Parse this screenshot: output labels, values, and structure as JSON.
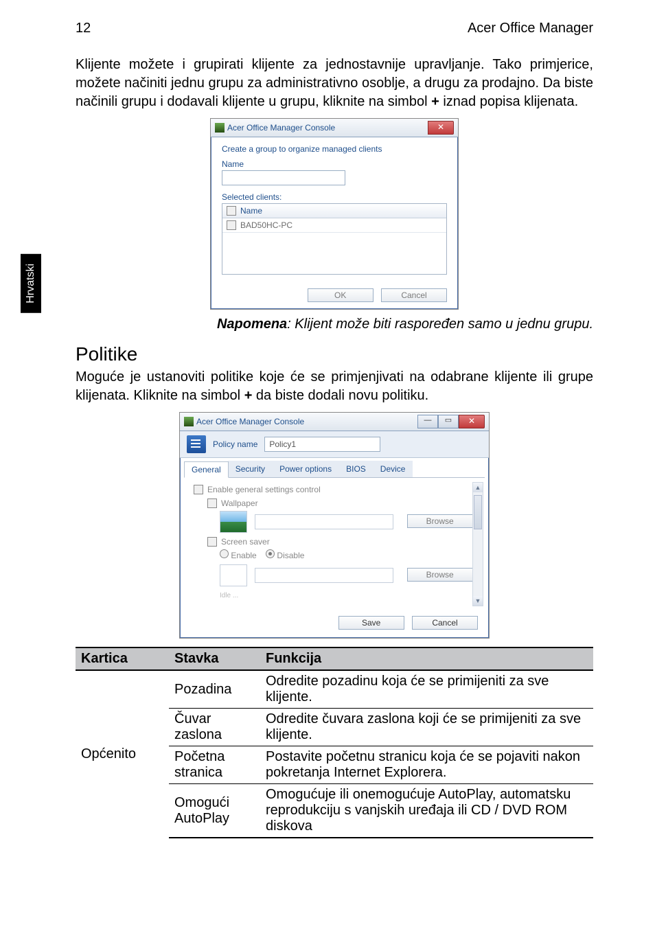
{
  "header": {
    "page_number": "12",
    "doc_title": "Acer Office Manager"
  },
  "side_tab": "Hrvatski",
  "para1_pre": "Klijente možete i grupirati klijente za jednostavnije upravljanje. Tako primjerice, možete načiniti jednu grupu za administrativno osoblje, a drugu za prodajno. Da biste načinili grupu i dodavali klijente u grupu, kliknite na simbol ",
  "para1_bold": "+",
  "para1_post": " iznad popisa klijenata.",
  "dialog1": {
    "title": "Acer Office Manager Console",
    "heading": "Create a group to organize managed clients",
    "name_label": "Name",
    "name_value": "",
    "selected_clients_label": "Selected clients:",
    "col_name": "Name",
    "client_row": "BAD50HC-PC",
    "ok": "OK",
    "cancel": "Cancel"
  },
  "note": {
    "bold": "Napomena",
    "rest": ": Klijent može biti raspoređen samo u jednu grupu."
  },
  "section_title": "Politike",
  "para2_pre": "Moguće je ustanoviti politike koje će se primjenjivati na odabrane klijente ili grupe klijenata. Kliknite na simbol ",
  "para2_bold": "+",
  "para2_post": " da biste dodali novu politiku.",
  "dialog2": {
    "title": "Acer Office Manager Console",
    "policy_name_label": "Policy name",
    "policy_name_value": "Policy1",
    "tabs": [
      "General",
      "Security",
      "Power options",
      "BIOS",
      "Device"
    ],
    "active_tab": 0,
    "enable_general": "Enable general settings control",
    "wallpaper": "Wallpaper",
    "screensaver": "Screen saver",
    "enable": "Enable",
    "disable": "Disable",
    "browse": "Browse",
    "idle": "Idle ...",
    "save": "Save",
    "cancel": "Cancel"
  },
  "table": {
    "headers": {
      "kartica": "Kartica",
      "stavka": "Stavka",
      "funkcija": "Funkcija"
    },
    "kartica": "Općenito",
    "rows": [
      {
        "stavka": "Pozadina",
        "funkcija": "Odredite pozadinu koja će se primijeniti za sve klijente."
      },
      {
        "stavka": "Čuvar zaslona",
        "funkcija": "Odredite čuvara zaslona koji će se primijeniti za sve klijente."
      },
      {
        "stavka": "Početna stranica",
        "funkcija": "Postavite početnu stranicu koja će se pojaviti nakon pokretanja Internet Explorera."
      },
      {
        "stavka": "Omogući AutoPlay",
        "funkcija": "Omogućuje ili onemogućuje AutoPlay, automatsku reprodukciju s vanjskih uređaja ili CD / DVD ROM diskova"
      }
    ]
  }
}
